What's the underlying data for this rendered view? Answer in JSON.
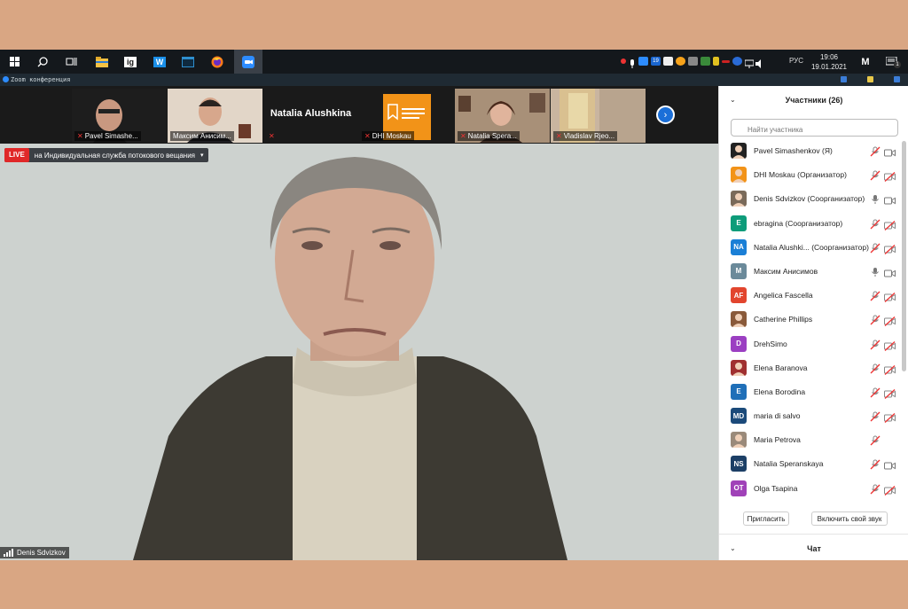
{
  "taskbar": {
    "language": "РУС",
    "time": "19:06",
    "date": "19.01.2021",
    "apps": [
      "start",
      "search",
      "task-view",
      "file-explorer",
      "ig",
      "wordweb",
      "app",
      "firefox",
      "zoom"
    ],
    "app_ig_label": "ig",
    "app_w_label": "W",
    "badge": "19",
    "notify_count": "1"
  },
  "titlebar": {
    "title": "Zoom конференция"
  },
  "gallery": {
    "thumbs": [
      {
        "name": "Pavel Simashe...",
        "muted": true
      },
      {
        "name": "Максим Анисим...",
        "muted": false
      },
      {
        "name": "",
        "display": "Natalia Alushkina",
        "muted": true
      },
      {
        "name": "DHI Moskau",
        "muted": true
      },
      {
        "name": "Natalia Spera...",
        "muted": true
      },
      {
        "name": "Vladislav Rjeo...",
        "muted": true
      }
    ]
  },
  "speaker": {
    "live_label": "LIVE",
    "service_label": "на Индивидуальная служба потокового вещания",
    "name": "Denis Sdvizkov"
  },
  "panel": {
    "title": "Участники (26)",
    "search_placeholder": "Найти участника",
    "participants": [
      {
        "name": "Pavel Simashenkov (Я)",
        "initials": "",
        "color": "#222222",
        "mic": "muted",
        "cam": "on"
      },
      {
        "name": "DHI Moskau (Организатор)",
        "initials": "",
        "color": "#f29318",
        "mic": "muted",
        "cam": "off"
      },
      {
        "name": "Denis Sdvizkov (Соорганизатор)",
        "initials": "",
        "color": "#7a6a5a",
        "mic": "on",
        "cam": "on"
      },
      {
        "name": "ebragina (Соорганизатор)",
        "initials": "E",
        "color": "#0e9c7a",
        "mic": "muted",
        "cam": "off"
      },
      {
        "name": "Natalia Alushki... (Соорганизатор)",
        "initials": "NA",
        "color": "#1a7fd6",
        "mic": "muted",
        "cam": "off"
      },
      {
        "name": "Максим Анисимов",
        "initials": "M",
        "color": "#6b8a9a",
        "mic": "on",
        "cam": "on"
      },
      {
        "name": "Angelica Fascella",
        "initials": "AF",
        "color": "#e2452e",
        "mic": "muted",
        "cam": "off"
      },
      {
        "name": "Catherine Phillips",
        "initials": "",
        "color": "#8a5a3a",
        "mic": "muted",
        "cam": "off"
      },
      {
        "name": "DrehSimo",
        "initials": "D",
        "color": "#9b3fc2",
        "mic": "muted",
        "cam": "off"
      },
      {
        "name": "Elena Baranova",
        "initials": "",
        "color": "#a03030",
        "mic": "muted",
        "cam": "off"
      },
      {
        "name": "Elena Borodina",
        "initials": "E",
        "color": "#1f6fb8",
        "mic": "muted",
        "cam": "off"
      },
      {
        "name": "maria di salvo",
        "initials": "MD",
        "color": "#1b4a7a",
        "mic": "muted",
        "cam": "off"
      },
      {
        "name": "Maria Petrova",
        "initials": "",
        "color": "#9a8a7a",
        "mic": "muted",
        "cam": "none"
      },
      {
        "name": "Natalia Speranskaya",
        "initials": "NS",
        "color": "#1c3f66",
        "mic": "muted",
        "cam": "on"
      },
      {
        "name": "Olga Tsapina",
        "initials": "OT",
        "color": "#a042b8",
        "mic": "muted",
        "cam": "off"
      }
    ],
    "invite_label": "Пригласить",
    "unmute_label": "Включить свой звук",
    "chat_title": "Чат"
  },
  "colors": {
    "live_red": "#e02828",
    "mute_red": "#e33333",
    "zoom_blue": "#1b6fd8"
  }
}
